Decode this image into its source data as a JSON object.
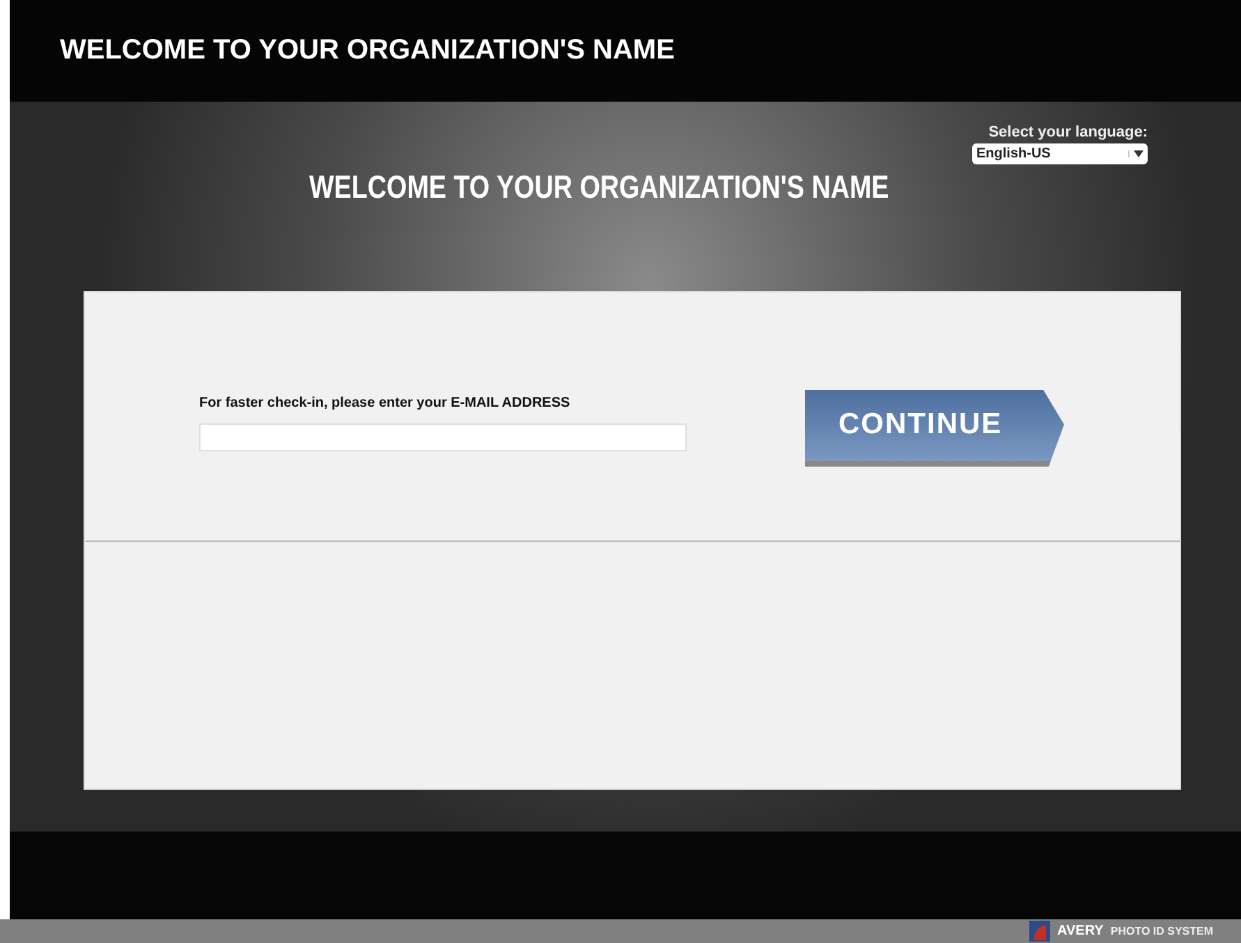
{
  "header": {
    "title": "WELCOME TO YOUR ORGANIZATION'S NAME"
  },
  "language": {
    "label": "Select your language:",
    "value": "English-US"
  },
  "heading": "WELCOME TO YOUR ORGANIZATION'S NAME",
  "email": {
    "label": "For faster check-in, please enter your E-MAIL ADDRESS"
  },
  "continue_button": "CONTINUE",
  "footer": {
    "brand": "AVERY",
    "product": "PHOTO ID SYSTEM"
  }
}
